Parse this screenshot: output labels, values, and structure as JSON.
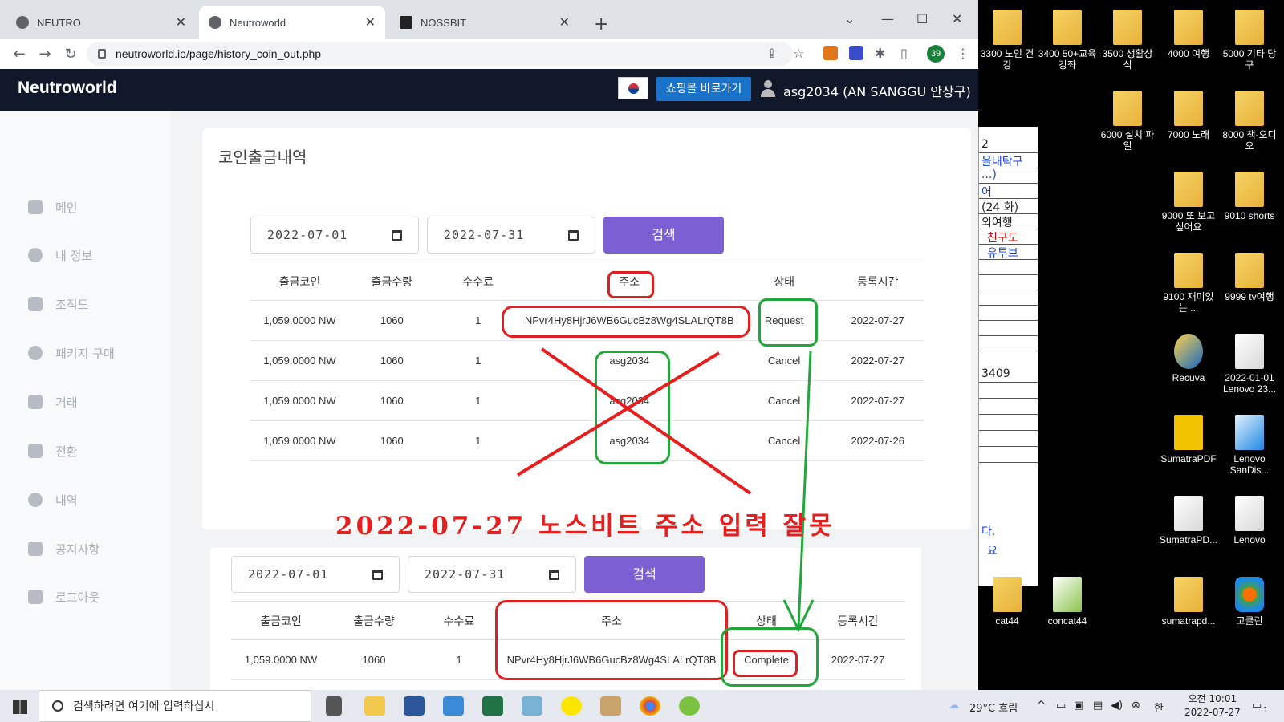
{
  "browser": {
    "tabs": [
      {
        "label": "NEUTRO"
      },
      {
        "label": "Neutroworld"
      },
      {
        "label": "NOSSBIT"
      }
    ],
    "url": "neutroworld.io/page/history_coin_out.php",
    "profile_badge": "39"
  },
  "site": {
    "logo": "Neutroworld",
    "shop_button": "쇼핑몰 바로가기",
    "user": "asg2034 (AN SANGGU 안상구)"
  },
  "sidebar": {
    "items": [
      {
        "label": "메인",
        "icon": "home-icon"
      },
      {
        "label": "내 정보",
        "icon": "user-icon"
      },
      {
        "label": "조직도",
        "icon": "org-chart-icon"
      },
      {
        "label": "패키지 구매",
        "icon": "money-bag-icon"
      },
      {
        "label": "거래",
        "icon": "wallet-icon"
      },
      {
        "label": "전환",
        "icon": "exchange-icon"
      },
      {
        "label": "내역",
        "icon": "money-bag-icon"
      },
      {
        "label": "공지사항",
        "icon": "chat-icon"
      },
      {
        "label": "로그아웃",
        "icon": "logout-icon"
      }
    ]
  },
  "main": {
    "title": "코인출금내역",
    "date_from": "2022-07-01",
    "date_to": "2022-07-31",
    "search_label": "검색",
    "columns": [
      "출금코인",
      "출금수량",
      "수수료",
      "주소",
      "상태",
      "등록시간"
    ],
    "rows": [
      {
        "coin": "1,059.0000 NW",
        "qty": "1060",
        "fee": "1",
        "address": "NPvr4Hy8HjrJ6WB6GucBz8Wg4SLALrQT8B",
        "status": "Request",
        "time": "2022-07-27"
      },
      {
        "coin": "1,059.0000 NW",
        "qty": "1060",
        "fee": "1",
        "address": "asg2034",
        "status": "Cancel",
        "time": "2022-07-27"
      },
      {
        "coin": "1,059.0000 NW",
        "qty": "1060",
        "fee": "1",
        "address": "asg2034",
        "status": "Cancel",
        "time": "2022-07-27"
      },
      {
        "coin": "1,059.0000 NW",
        "qty": "1060",
        "fee": "1",
        "address": "asg2034",
        "status": "Cancel",
        "time": "2022-07-26"
      }
    ]
  },
  "annotation": "2022-07-27 노스비트 주소 입력 잘못",
  "second_panel": {
    "date_from": "2022-07-01",
    "date_to": "2022-07-31",
    "search_label": "검색",
    "columns": [
      "출금코인",
      "출금수량",
      "수수료",
      "주소",
      "상태",
      "등록시간"
    ],
    "rows": [
      {
        "coin": "1,059.0000 NW",
        "qty": "1060",
        "fee": "1",
        "address": "NPvr4Hy8HjrJ6WB6GucBz8Wg4SLALrQT8B",
        "status": "Complete",
        "time": "2022-07-27"
      }
    ]
  },
  "side_window": {
    "lines": [
      "2",
      "을내탁구",
      "...)",
      "어",
      "(24 화)",
      "외여행",
      "친구도",
      "유투브",
      "",
      "",
      "",
      "",
      "",
      "",
      "3409",
      "",
      "",
      "",
      "",
      "",
      "다.",
      "요"
    ]
  },
  "desktop": {
    "icons": [
      {
        "label": "3300 노인 건강"
      },
      {
        "label": "3400 50+교육강좌"
      },
      {
        "label": "3500 생활상식"
      },
      {
        "label": "4000 여행"
      },
      {
        "label": "5000 기타 당구"
      },
      {
        "label": "6000 설치 파일"
      },
      {
        "label": "7000 노래"
      },
      {
        "label": "8000 책-오디오"
      },
      {
        "label": "9000 또 보고 싶어요"
      },
      {
        "label": "9010 shorts"
      },
      {
        "label": "9100 재미있는 ..."
      },
      {
        "label": "9999 tv여행"
      },
      {
        "label": "Recuva"
      },
      {
        "label": "2022-01-01 Lenovo 23..."
      },
      {
        "label": "SumatraPDF"
      },
      {
        "label": "Lenovo SanDis..."
      },
      {
        "label": "SumatraPD..."
      },
      {
        "label": "Lenovo"
      },
      {
        "label": "cat44"
      },
      {
        "label": "concat44"
      },
      {
        "label": "sumatrapd..."
      },
      {
        "label": "고클린"
      }
    ]
  },
  "taskbar": {
    "search_placeholder": "검색하려면 여기에 입력하십시",
    "weather": "29°C 흐림",
    "ime": "한",
    "time": "오전 10:01",
    "date": "2022-07-27",
    "notification_count": "1"
  },
  "colors": {
    "header_bg": "#10182a",
    "accent_purple": "#7b5fd3",
    "annotation_red": "#e81e1e",
    "annotation_green": "#22a83a"
  }
}
